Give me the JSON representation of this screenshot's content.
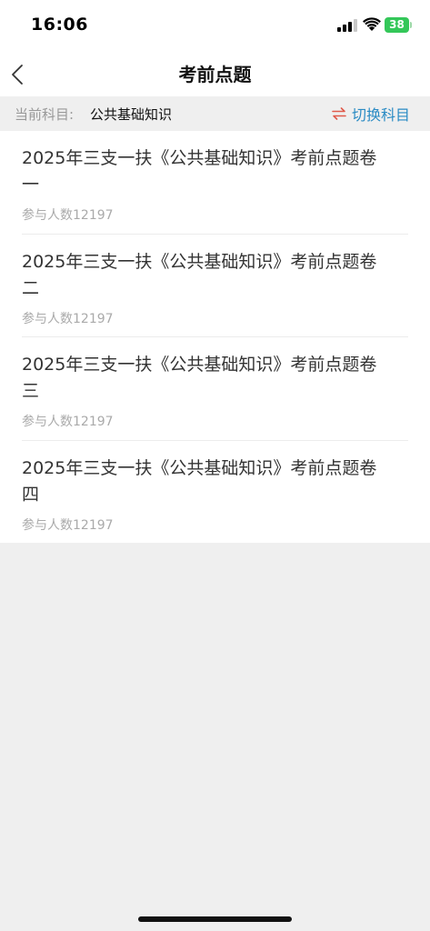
{
  "status_bar": {
    "time": "16:06",
    "battery": "38",
    "icons": [
      "signal-icon",
      "wifi-icon",
      "battery-icon"
    ]
  },
  "nav": {
    "title": "考前点题",
    "back_icon": "chevron-left-icon"
  },
  "subject": {
    "label": "当前科目:",
    "value": "公共基础知识",
    "switch_label": "切换科目",
    "switch_icon": "swap-arrows-icon",
    "switch_icon_color": "#e05a4b",
    "accent_color": "#2a8bc4"
  },
  "exams": [
    {
      "title": "2025年三支一扶《公共基础知识》考前点题卷一",
      "count": "参与人数12197"
    },
    {
      "title": "2025年三支一扶《公共基础知识》考前点题卷二",
      "count": "参与人数12197"
    },
    {
      "title": "2025年三支一扶《公共基础知识》考前点题卷三",
      "count": "参与人数12197"
    },
    {
      "title": "2025年三支一扶《公共基础知识》考前点题卷四",
      "count": "参与人数12197"
    }
  ]
}
